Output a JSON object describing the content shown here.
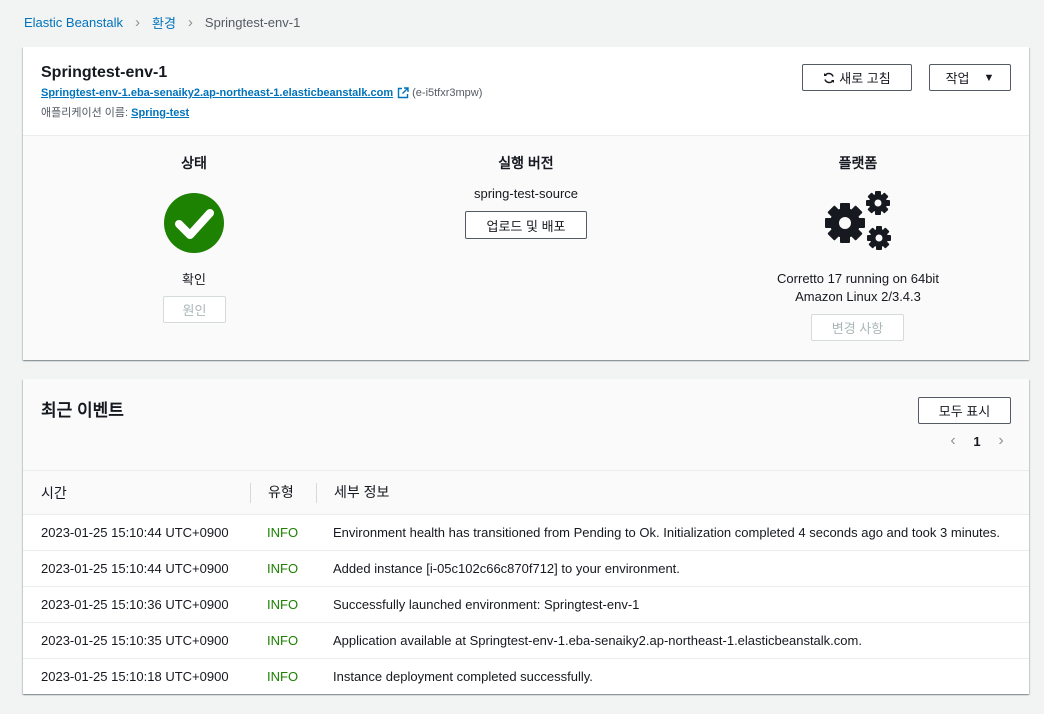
{
  "breadcrumb": {
    "root": "Elastic Beanstalk",
    "section": "환경",
    "current": "Springtest-env-1"
  },
  "environment": {
    "name": "Springtest-env-1",
    "url": "Springtest-env-1.eba-senaiky2.ap-northeast-1.elasticbeanstalk.com",
    "env_id": "(e-i5tfxr3mpw)",
    "app_label": "애플리케이션 이름:",
    "app_name": "Spring-test",
    "refresh_label": "새로 고침",
    "actions_label": "작업"
  },
  "status": {
    "title": "상태",
    "value": "확인",
    "causes_label": "원인",
    "color": "#1d8102"
  },
  "version": {
    "title": "실행 버전",
    "value": "spring-test-source",
    "upload_label": "업로드 및 배포"
  },
  "platform": {
    "title": "플랫폼",
    "line1": "Corretto 17 running on 64bit",
    "line2": "Amazon Linux 2/3.4.3",
    "change_label": "변경 사항"
  },
  "events": {
    "title": "최근 이벤트",
    "show_all_label": "모두 표시",
    "page": "1",
    "columns": [
      "시간",
      "유형",
      "세부 정보"
    ],
    "rows": [
      {
        "time": "2023-01-25 15:10:44 UTC+0900",
        "type": "INFO",
        "details": "Environment health has transitioned from Pending to Ok. Initialization completed 4 seconds ago and took 3 minutes."
      },
      {
        "time": "2023-01-25 15:10:44 UTC+0900",
        "type": "INFO",
        "details": "Added instance [i-05c102c66c870f712] to your environment."
      },
      {
        "time": "2023-01-25 15:10:36 UTC+0900",
        "type": "INFO",
        "details": "Successfully launched environment: Springtest-env-1"
      },
      {
        "time": "2023-01-25 15:10:35 UTC+0900",
        "type": "INFO",
        "details": "Application available at Springtest-env-1.eba-senaiky2.ap-northeast-1.elasticbeanstalk.com."
      },
      {
        "time": "2023-01-25 15:10:18 UTC+0900",
        "type": "INFO",
        "details": "Instance deployment completed successfully."
      }
    ]
  }
}
